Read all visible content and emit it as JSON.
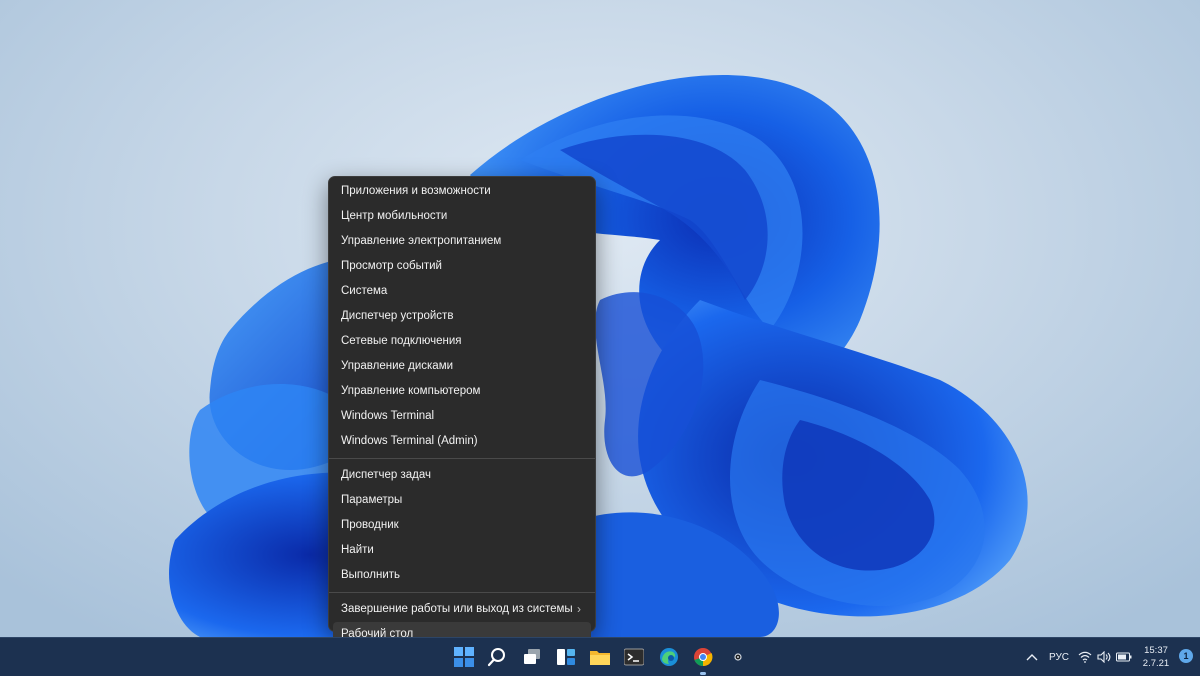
{
  "context_menu": {
    "group1": [
      "Приложения и возможности",
      "Центр мобильности",
      "Управление электропитанием",
      "Просмотр событий",
      "Система",
      "Диспетчер устройств",
      "Сетевые подключения",
      "Управление дисками",
      "Управление компьютером",
      "Windows Terminal",
      "Windows Terminal (Admin)"
    ],
    "group2": [
      "Диспетчер задач",
      "Параметры",
      "Проводник",
      "Найти",
      "Выполнить"
    ],
    "shutdown": {
      "label": "Завершение работы или выход из системы",
      "chevron": "›"
    },
    "desktop": "Рабочий стол"
  },
  "taskbar": {
    "icons": [
      "windows-start-icon",
      "search-icon",
      "task-view-icon",
      "widgets-icon",
      "file-explorer-icon",
      "terminal-icon",
      "edge-icon",
      "chrome-icon",
      "settings-icon"
    ],
    "tray": {
      "expand_icon": "chevron-up-icon",
      "language": "РУС",
      "icons": [
        "wifi-icon",
        "volume-icon",
        "battery-icon"
      ],
      "time": "15:37",
      "date": "2.7.21",
      "notifications": "1"
    }
  },
  "colors": {
    "menu_bg": "#2b2b2b",
    "taskbar_bg": "#1c3150",
    "bloom_blue": "#1a5fe0",
    "notification_badge": "#5fa8ea"
  }
}
